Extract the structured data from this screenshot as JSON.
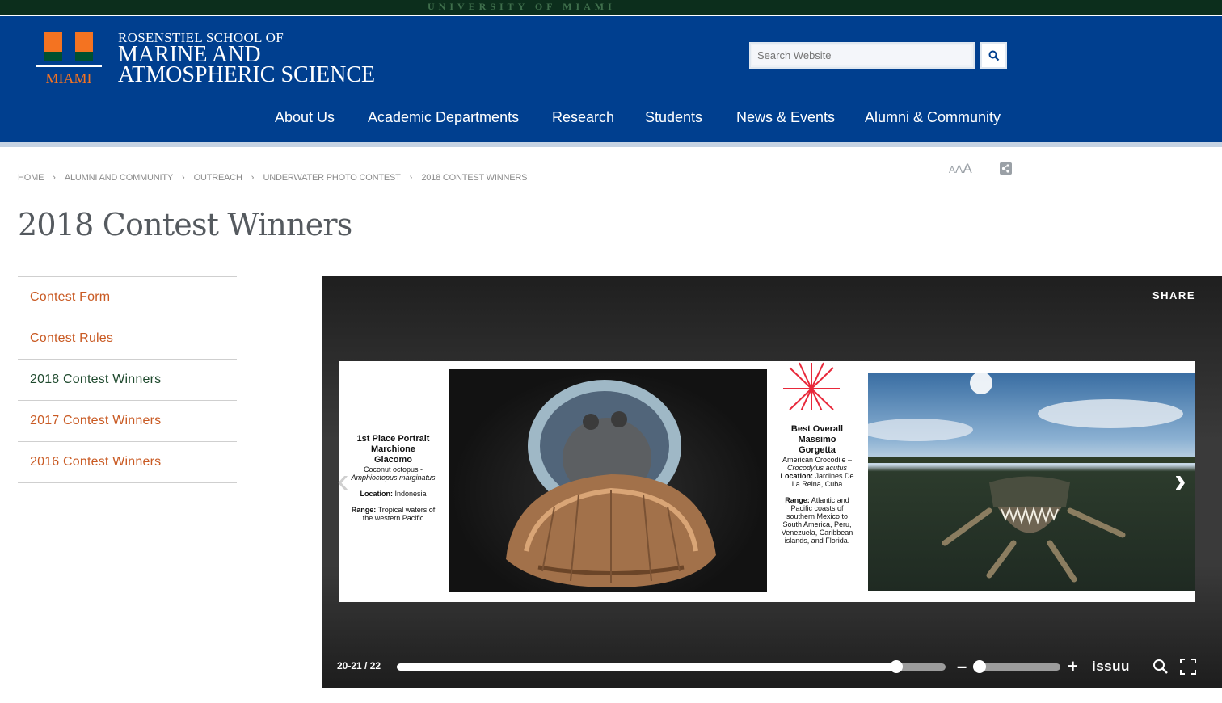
{
  "top_strip": {
    "university": "UNIVERSITY OF MIAMI"
  },
  "header": {
    "logo_text": "MIAMI",
    "school_line1": "ROSENSTIEL SCHOOL OF",
    "school_line2": "MARINE AND",
    "school_line3": "ATMOSPHERIC SCIENCE",
    "search_placeholder": "Search Website",
    "brand_color": "#003f8f",
    "accent_orange": "#f47321",
    "accent_green": "#005030"
  },
  "nav": {
    "items": [
      {
        "label": "About Us"
      },
      {
        "label": "Academic Departments"
      },
      {
        "label": "Research"
      },
      {
        "label": "Students"
      },
      {
        "label": "News & Events"
      },
      {
        "label": "Alumni & Community"
      }
    ]
  },
  "breadcrumb": [
    "HOME",
    "ALUMNI AND COMMUNITY",
    "OUTREACH",
    "UNDERWATER PHOTO CONTEST",
    "2018 CONTEST WINNERS"
  ],
  "text_size_control": {
    "small": "A",
    "medium": "A",
    "large": "A"
  },
  "page_title": "2018 Contest Winners",
  "side_nav": {
    "items": [
      {
        "label": "Contest Form",
        "current": false
      },
      {
        "label": "Contest Rules",
        "current": false
      },
      {
        "label": "2018 Contest Winners",
        "current": true
      },
      {
        "label": "2017 Contest Winners",
        "current": false
      },
      {
        "label": "2016 Contest Winners",
        "current": false
      }
    ]
  },
  "viewer": {
    "share_label": "SHARE",
    "caption1": {
      "title1": "1st Place Portrait",
      "title2": "Marchione",
      "title3": "Giacomo",
      "species": "Coconut octopus -",
      "latin": "Amphioctopus marginatus",
      "location_label": "Location:",
      "location": "Indonesia",
      "range_label": "Range:",
      "range": "Tropical waters of the western Pacific"
    },
    "caption2": {
      "title1": "Best Overall",
      "title2": "Massimo",
      "title3": "Gorgetta",
      "species": "American Crocodile –",
      "latin": "Crocodylus acutus",
      "location_label": "Location:",
      "location": "Jardines De La Reina, Cuba",
      "range_label": "Range:",
      "range": "Atlantic and Pacific coasts of southern Mexico to South America, Peru, Venezuela, Caribbean islands, and Florida."
    },
    "page_count": "20-21 / 22",
    "page_progress": 0.91,
    "zoom_level": 0.0,
    "brand": "issuu"
  }
}
